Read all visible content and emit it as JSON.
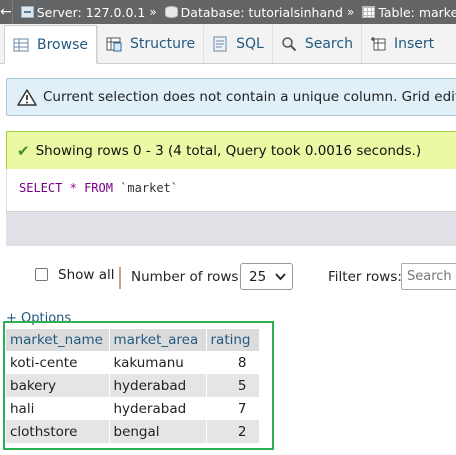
{
  "breadcrumb": {
    "server": "Server: 127.0.0.1",
    "database": "Database: tutorialsinhand",
    "table": "Table: market",
    "separator": "»"
  },
  "tabs": [
    {
      "label": "Browse",
      "icon": "browse-icon"
    },
    {
      "label": "Structure",
      "icon": "structure-icon"
    },
    {
      "label": "SQL",
      "icon": "sql-icon"
    },
    {
      "label": "Search",
      "icon": "search-icon"
    },
    {
      "label": "Insert",
      "icon": "insert-icon"
    }
  ],
  "notice": {
    "text": "Current selection does not contain a unique column. Grid edit, checkbox"
  },
  "success": {
    "text": "Showing rows 0 - 3 (4 total, Query took 0.0016 seconds.)"
  },
  "sql": {
    "select": "SELECT",
    "star": "*",
    "from": "FROM",
    "table": "`market`"
  },
  "controls": {
    "show_all": "Show all",
    "number_of_rows_label": "Number of rows:",
    "number_of_rows_value": "25",
    "filter_label": "Filter rows:",
    "filter_placeholder": "Search t"
  },
  "options_link": "+ Options",
  "table": {
    "columns": [
      "market_name",
      "market_area",
      "rating"
    ],
    "rows": [
      [
        "koti-cente",
        "kakumanu",
        "8"
      ],
      [
        "bakery",
        "hyderabad",
        "5"
      ],
      [
        "hali",
        "hyderabad",
        "7"
      ],
      [
        "clothstore",
        "bengal",
        "2"
      ]
    ]
  },
  "colors": {
    "crumb_bar": "#646566",
    "link": "#235a81",
    "notice_bg": "#e1f0f8",
    "success_bg": "#ebf8a4",
    "highlight_border": "#2eaf51"
  }
}
